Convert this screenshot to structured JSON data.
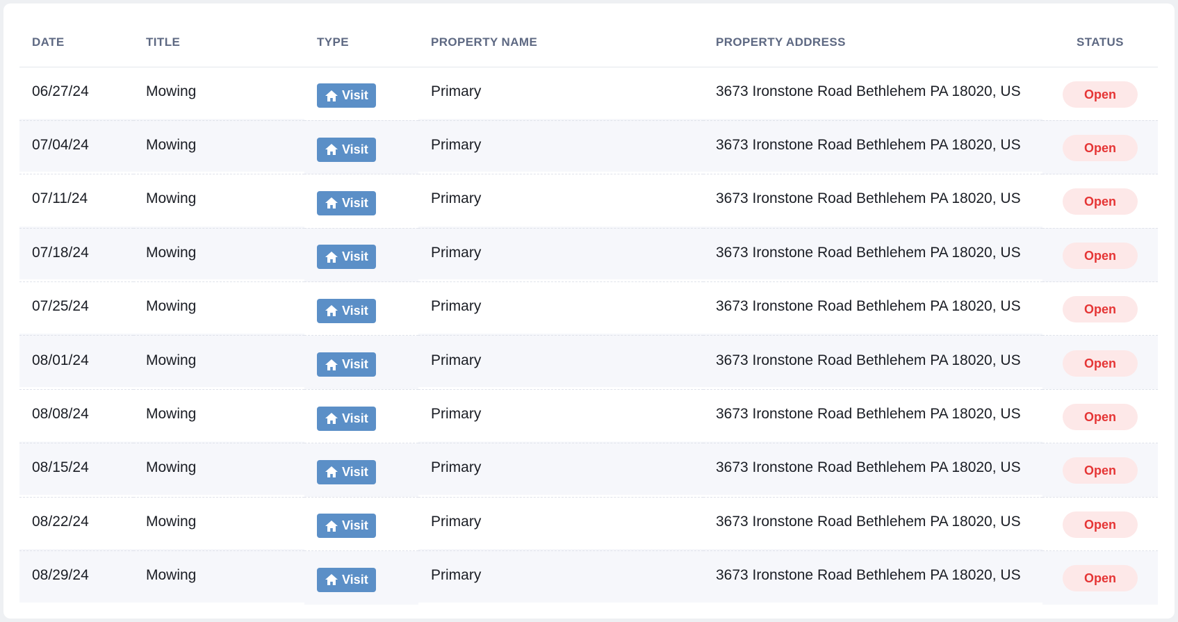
{
  "table": {
    "columns": {
      "date": "DATE",
      "title": "TITLE",
      "type": "TYPE",
      "property_name": "PROPERTY NAME",
      "property_address": "PROPERTY ADDRESS",
      "status": "STATUS"
    },
    "rows": [
      {
        "date": "06/27/24",
        "title": "Mowing",
        "type": "Visit",
        "type_icon": "home-icon",
        "property_name": "Primary",
        "property_address": "3673 Ironstone Road Bethlehem PA 18020, US",
        "status": "Open"
      },
      {
        "date": "07/04/24",
        "title": "Mowing",
        "type": "Visit",
        "type_icon": "home-icon",
        "property_name": "Primary",
        "property_address": "3673 Ironstone Road Bethlehem PA 18020, US",
        "status": "Open"
      },
      {
        "date": "07/11/24",
        "title": "Mowing",
        "type": "Visit",
        "type_icon": "home-icon",
        "property_name": "Primary",
        "property_address": "3673 Ironstone Road Bethlehem PA 18020, US",
        "status": "Open"
      },
      {
        "date": "07/18/24",
        "title": "Mowing",
        "type": "Visit",
        "type_icon": "home-icon",
        "property_name": "Primary",
        "property_address": "3673 Ironstone Road Bethlehem PA 18020, US",
        "status": "Open"
      },
      {
        "date": "07/25/24",
        "title": "Mowing",
        "type": "Visit",
        "type_icon": "home-icon",
        "property_name": "Primary",
        "property_address": "3673 Ironstone Road Bethlehem PA 18020, US",
        "status": "Open"
      },
      {
        "date": "08/01/24",
        "title": "Mowing",
        "type": "Visit",
        "type_icon": "home-icon",
        "property_name": "Primary",
        "property_address": "3673 Ironstone Road Bethlehem PA 18020, US",
        "status": "Open"
      },
      {
        "date": "08/08/24",
        "title": "Mowing",
        "type": "Visit",
        "type_icon": "home-icon",
        "property_name": "Primary",
        "property_address": "3673 Ironstone Road Bethlehem PA 18020, US",
        "status": "Open"
      },
      {
        "date": "08/15/24",
        "title": "Mowing",
        "type": "Visit",
        "type_icon": "home-icon",
        "property_name": "Primary",
        "property_address": "3673 Ironstone Road Bethlehem PA 18020, US",
        "status": "Open"
      },
      {
        "date": "08/22/24",
        "title": "Mowing",
        "type": "Visit",
        "type_icon": "home-icon",
        "property_name": "Primary",
        "property_address": "3673 Ironstone Road Bethlehem PA 18020, US",
        "status": "Open"
      },
      {
        "date": "08/29/24",
        "title": "Mowing",
        "type": "Visit",
        "type_icon": "home-icon",
        "property_name": "Primary",
        "property_address": "3673 Ironstone Road Bethlehem PA 18020, US",
        "status": "Open"
      }
    ]
  },
  "colors": {
    "header_text": "#5d6882",
    "type_badge_bg": "#5b8fc7",
    "status_open_bg": "#fde8e8",
    "status_open_text": "#e53535",
    "row_stripe": "#f6f7fb"
  }
}
